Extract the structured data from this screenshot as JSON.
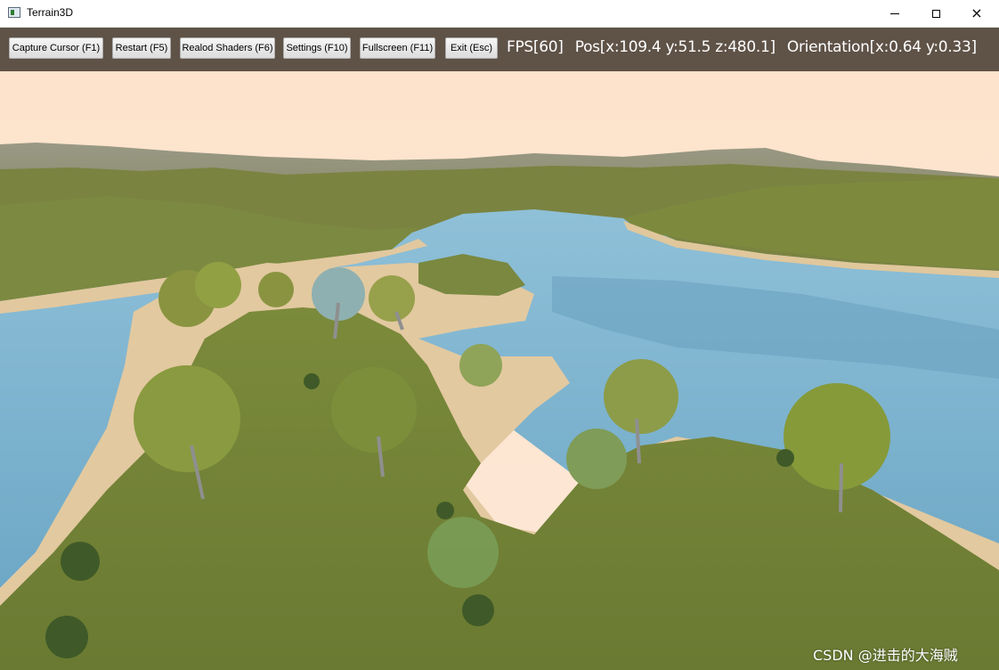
{
  "window": {
    "title": "Terrain3D",
    "controls": {
      "minimize": "minimize",
      "maximize": "maximize",
      "close": "×"
    }
  },
  "toolbar": {
    "buttons": [
      {
        "label": "Capture Cursor (F1)"
      },
      {
        "label": "Restart (F5)"
      },
      {
        "label": "Realod Shaders (F6)"
      },
      {
        "label": "Settings (F10)"
      },
      {
        "label": "Fullscreen (F11)"
      },
      {
        "label": "Exit (Esc)"
      }
    ]
  },
  "stats": {
    "fps": "FPS[60]",
    "position": "Pos[x:109.4 y:51.5 z:480.1]",
    "orientation": "Orientation[x:0.64 y:0.33]"
  },
  "viewport": {
    "description_icon": "terrain-scene",
    "colors": {
      "sky": "#fde5cf",
      "water": "#7fb3cd",
      "sand": "#e2c9a0",
      "grass": "#7e8a3a",
      "far_hills": "#8e8f78"
    }
  },
  "watermark": "CSDN @进击的大海贼"
}
